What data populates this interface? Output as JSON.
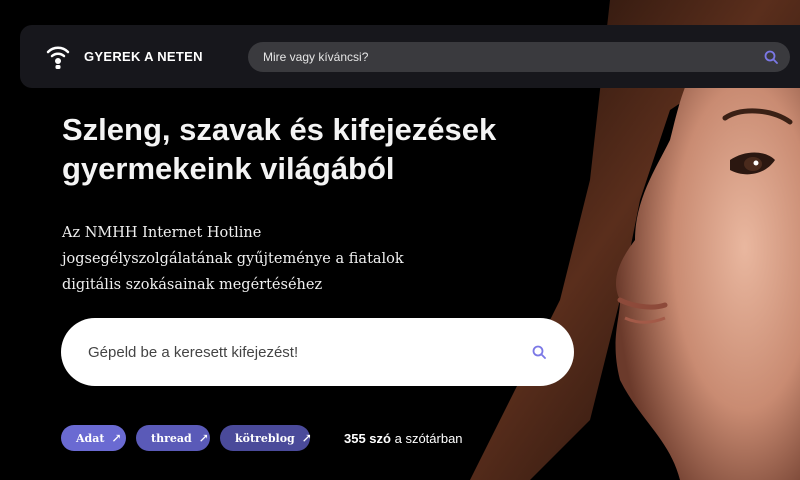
{
  "header": {
    "brand_name": "GYEREK A NETEN",
    "brand_icon": "wifi-figure-icon",
    "search_placeholder": "Mire vagy kíváncsi?",
    "search_icon": "search-icon"
  },
  "hero": {
    "title_line1": "Szleng, szavak és kifejezések",
    "title_line2": "gyermekeink világából",
    "subtitle_line1": "Az NMHH Internet Hotline",
    "subtitle_line2": "jogsegélyszolgálatának gyűjteménye a fiatalok",
    "subtitle_line3": "digitális szokásainak megértéséhez",
    "search_placeholder": "Gépeld be a keresett kifejezést!",
    "tags": [
      {
        "label": "Adat"
      },
      {
        "label": "thread"
      },
      {
        "label": "kötreblog"
      }
    ],
    "count_number": "355 szó",
    "count_suffix": "a szótárban"
  },
  "colors": {
    "accent": "#6a6ad2",
    "search_icon": "#7b78e6",
    "topbar_bg": "#17171c"
  }
}
